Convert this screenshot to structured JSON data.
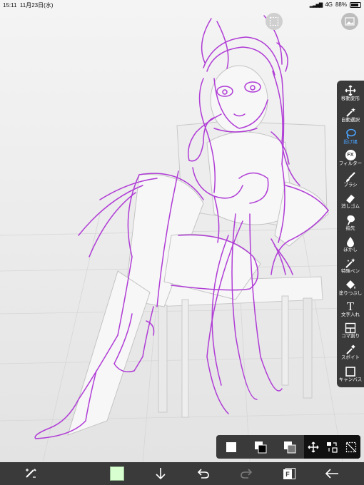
{
  "status": {
    "time": "15:11",
    "date": "11月23日(水)",
    "signal": "4G",
    "battery": "88%"
  },
  "tools": [
    {
      "label": "移動変形",
      "icon": "move-icon"
    },
    {
      "label": "自動選択",
      "icon": "magic-wand-icon"
    },
    {
      "label": "投げ縄",
      "icon": "lasso-icon",
      "active": true
    },
    {
      "label": "フィルター",
      "icon": "fx-icon"
    },
    {
      "label": "ブラシ",
      "icon": "brush-icon"
    },
    {
      "label": "消しゴム",
      "icon": "eraser-icon"
    },
    {
      "label": "指先",
      "icon": "finger-icon"
    },
    {
      "label": "ぼかし",
      "icon": "blur-drop-icon"
    },
    {
      "label": "特殊ペン",
      "icon": "special-pen-icon"
    },
    {
      "label": "塗りつぶし",
      "icon": "bucket-icon"
    },
    {
      "label": "文字入れ",
      "icon": "text-icon"
    },
    {
      "label": "コマ割り",
      "icon": "frame-divide-icon"
    },
    {
      "label": "スポイト",
      "icon": "eyedropper-icon"
    },
    {
      "label": "キャンバス",
      "icon": "canvas-icon"
    }
  ],
  "fx_text": "FX",
  "text_tool_glyph": "T",
  "bottom": {
    "primary_color": "#d8ffd0",
    "layer_glyph": "F"
  },
  "accent": "#4aa3ff",
  "sketch_color": "#b03cd6"
}
